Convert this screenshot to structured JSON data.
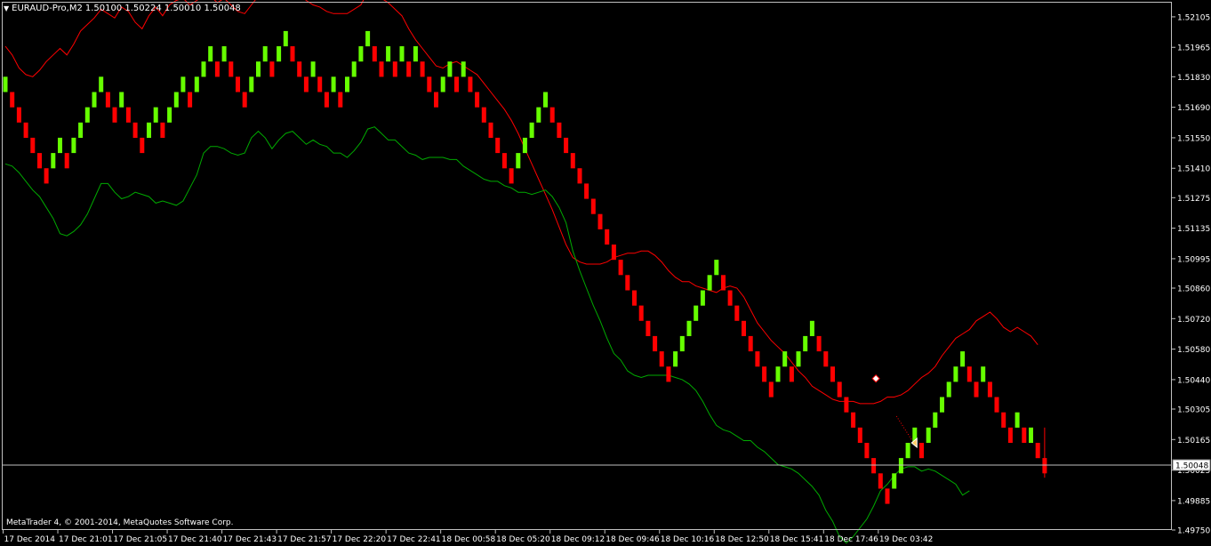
{
  "header": {
    "menu_icon": "triangle-down-icon",
    "symbol": "EURAUD-Pro,M2",
    "ohlc": "1.50100 1.50224 1.50010 1.50048"
  },
  "footer": {
    "copyright": "MetaTrader 4, © 2001-2014, MetaQuotes Software Corp."
  },
  "colors": {
    "background": "#000000",
    "bull": "#66ff00",
    "bear": "#ff0000",
    "upper_band": "#ff0000",
    "lower_band": "#00aa00",
    "frame": "#c0c0c0",
    "text": "#ffffff",
    "price_line": "#c0c0c0"
  },
  "chart_data": {
    "type": "renko",
    "symbol": "EURAUD-Pro",
    "timeframe": "M2",
    "box_size": 0.0007,
    "current_price": 1.50048,
    "current_price_label": "1.50048",
    "ylim": [
      1.4975,
      1.5217
    ],
    "y_ticks": [
      "1.52105",
      "1.51965",
      "1.51830",
      "1.51690",
      "1.51550",
      "1.51410",
      "1.51275",
      "1.51135",
      "1.50995",
      "1.50860",
      "1.50720",
      "1.50580",
      "1.50440",
      "1.50305",
      "1.50165",
      "1.50025",
      "1.49885",
      "1.49750"
    ],
    "y_tick_values": [
      1.52105,
      1.51965,
      1.5183,
      1.5169,
      1.5155,
      1.5141,
      1.51275,
      1.51135,
      1.50995,
      1.5086,
      1.5072,
      1.5058,
      1.5044,
      1.50305,
      1.50165,
      1.50025,
      1.49885,
      1.4975
    ],
    "x_ticks": [
      "17 Dec 2014",
      "17 Dec 21:01",
      "17 Dec 21:05",
      "17 Dec 21:40",
      "17 Dec 21:43",
      "17 Dec 21:57",
      "17 Dec 22:20",
      "17 Dec 22:41",
      "18 Dec 00:58",
      "18 Dec 05:20",
      "18 Dec 09:12",
      "18 Dec 09:46",
      "18 Dec 10:16",
      "18 Dec 12:50",
      "18 Dec 15:41",
      "18 Dec 17:46",
      "19 Dec 03:42"
    ],
    "x_tick_bar_index": [
      0,
      8,
      16,
      24,
      32,
      40,
      48,
      56,
      64,
      72,
      80,
      88,
      96,
      104,
      112,
      120,
      128
    ],
    "bars": [
      {
        "c": "up",
        "lo": 1.5176,
        "hi": 1.5183
      },
      {
        "c": "dn",
        "lo": 1.5169,
        "hi": 1.5176
      },
      {
        "c": "dn",
        "lo": 1.5162,
        "hi": 1.5169
      },
      {
        "c": "dn",
        "lo": 1.5155,
        "hi": 1.5162
      },
      {
        "c": "dn",
        "lo": 1.5148,
        "hi": 1.5155
      },
      {
        "c": "dn",
        "lo": 1.5141,
        "hi": 1.5148
      },
      {
        "c": "dn",
        "lo": 1.5134,
        "hi": 1.5141
      },
      {
        "c": "up",
        "lo": 1.5141,
        "hi": 1.5148
      },
      {
        "c": "up",
        "lo": 1.5148,
        "hi": 1.5155
      },
      {
        "c": "dn",
        "lo": 1.5141,
        "hi": 1.5148
      },
      {
        "c": "up",
        "lo": 1.5148,
        "hi": 1.5155
      },
      {
        "c": "up",
        "lo": 1.5155,
        "hi": 1.5162
      },
      {
        "c": "up",
        "lo": 1.5162,
        "hi": 1.5169
      },
      {
        "c": "up",
        "lo": 1.5169,
        "hi": 1.5176
      },
      {
        "c": "up",
        "lo": 1.5176,
        "hi": 1.5183
      },
      {
        "c": "dn",
        "lo": 1.5169,
        "hi": 1.5176
      },
      {
        "c": "dn",
        "lo": 1.5162,
        "hi": 1.5169
      },
      {
        "c": "up",
        "lo": 1.5169,
        "hi": 1.5176
      },
      {
        "c": "dn",
        "lo": 1.5162,
        "hi": 1.5169
      },
      {
        "c": "dn",
        "lo": 1.5155,
        "hi": 1.5162
      },
      {
        "c": "dn",
        "lo": 1.5148,
        "hi": 1.5155
      },
      {
        "c": "up",
        "lo": 1.5155,
        "hi": 1.5162
      },
      {
        "c": "up",
        "lo": 1.5162,
        "hi": 1.5169
      },
      {
        "c": "dn",
        "lo": 1.5155,
        "hi": 1.5162
      },
      {
        "c": "up",
        "lo": 1.5162,
        "hi": 1.5169
      },
      {
        "c": "up",
        "lo": 1.5169,
        "hi": 1.5176
      },
      {
        "c": "up",
        "lo": 1.5176,
        "hi": 1.5183
      },
      {
        "c": "dn",
        "lo": 1.5169,
        "hi": 1.5176
      },
      {
        "c": "up",
        "lo": 1.5176,
        "hi": 1.5183
      },
      {
        "c": "up",
        "lo": 1.5183,
        "hi": 1.519
      },
      {
        "c": "up",
        "lo": 1.519,
        "hi": 1.5197
      },
      {
        "c": "dn",
        "lo": 1.5183,
        "hi": 1.519
      },
      {
        "c": "up",
        "lo": 1.519,
        "hi": 1.5197
      },
      {
        "c": "dn",
        "lo": 1.5183,
        "hi": 1.519
      },
      {
        "c": "dn",
        "lo": 1.5176,
        "hi": 1.5183
      },
      {
        "c": "dn",
        "lo": 1.5169,
        "hi": 1.5176
      },
      {
        "c": "up",
        "lo": 1.5176,
        "hi": 1.5183
      },
      {
        "c": "up",
        "lo": 1.5183,
        "hi": 1.519
      },
      {
        "c": "up",
        "lo": 1.519,
        "hi": 1.5197
      },
      {
        "c": "dn",
        "lo": 1.5183,
        "hi": 1.519
      },
      {
        "c": "up",
        "lo": 1.519,
        "hi": 1.5197
      },
      {
        "c": "up",
        "lo": 1.5197,
        "hi": 1.5204
      },
      {
        "c": "dn",
        "lo": 1.519,
        "hi": 1.5197
      },
      {
        "c": "dn",
        "lo": 1.5183,
        "hi": 1.519
      },
      {
        "c": "dn",
        "lo": 1.5176,
        "hi": 1.5183
      },
      {
        "c": "up",
        "lo": 1.5183,
        "hi": 1.519
      },
      {
        "c": "dn",
        "lo": 1.5176,
        "hi": 1.5183
      },
      {
        "c": "dn",
        "lo": 1.5169,
        "hi": 1.5176
      },
      {
        "c": "up",
        "lo": 1.5176,
        "hi": 1.5183
      },
      {
        "c": "dn",
        "lo": 1.5169,
        "hi": 1.5176
      },
      {
        "c": "up",
        "lo": 1.5176,
        "hi": 1.5183
      },
      {
        "c": "up",
        "lo": 1.5183,
        "hi": 1.519
      },
      {
        "c": "up",
        "lo": 1.519,
        "hi": 1.5197
      },
      {
        "c": "up",
        "lo": 1.5197,
        "hi": 1.5204
      },
      {
        "c": "dn",
        "lo": 1.519,
        "hi": 1.5197
      },
      {
        "c": "dn",
        "lo": 1.5183,
        "hi": 1.519
      },
      {
        "c": "up",
        "lo": 1.519,
        "hi": 1.5197
      },
      {
        "c": "dn",
        "lo": 1.5183,
        "hi": 1.519
      },
      {
        "c": "up",
        "lo": 1.519,
        "hi": 1.5197
      },
      {
        "c": "dn",
        "lo": 1.5183,
        "hi": 1.519
      },
      {
        "c": "up",
        "lo": 1.519,
        "hi": 1.5197
      },
      {
        "c": "dn",
        "lo": 1.5183,
        "hi": 1.519
      },
      {
        "c": "dn",
        "lo": 1.5176,
        "hi": 1.5183
      },
      {
        "c": "dn",
        "lo": 1.5169,
        "hi": 1.5176
      },
      {
        "c": "up",
        "lo": 1.5176,
        "hi": 1.5183
      },
      {
        "c": "up",
        "lo": 1.5183,
        "hi": 1.519
      },
      {
        "c": "dn",
        "lo": 1.5176,
        "hi": 1.5183
      },
      {
        "c": "up",
        "lo": 1.5183,
        "hi": 1.519
      },
      {
        "c": "dn",
        "lo": 1.5176,
        "hi": 1.5183
      },
      {
        "c": "dn",
        "lo": 1.5169,
        "hi": 1.5176
      },
      {
        "c": "dn",
        "lo": 1.5162,
        "hi": 1.5169
      },
      {
        "c": "dn",
        "lo": 1.5155,
        "hi": 1.5162
      },
      {
        "c": "dn",
        "lo": 1.5148,
        "hi": 1.5155
      },
      {
        "c": "dn",
        "lo": 1.5141,
        "hi": 1.5148
      },
      {
        "c": "dn",
        "lo": 1.5134,
        "hi": 1.5141
      },
      {
        "c": "up",
        "lo": 1.5141,
        "hi": 1.5148
      },
      {
        "c": "up",
        "lo": 1.5148,
        "hi": 1.5155
      },
      {
        "c": "up",
        "lo": 1.5155,
        "hi": 1.5162
      },
      {
        "c": "up",
        "lo": 1.5162,
        "hi": 1.5169
      },
      {
        "c": "up",
        "lo": 1.5169,
        "hi": 1.5176
      },
      {
        "c": "dn",
        "lo": 1.5162,
        "hi": 1.5169
      },
      {
        "c": "dn",
        "lo": 1.5155,
        "hi": 1.5162
      },
      {
        "c": "dn",
        "lo": 1.5148,
        "hi": 1.5155
      },
      {
        "c": "dn",
        "lo": 1.5141,
        "hi": 1.5148
      },
      {
        "c": "dn",
        "lo": 1.5134,
        "hi": 1.5141
      },
      {
        "c": "dn",
        "lo": 1.5127,
        "hi": 1.5134
      },
      {
        "c": "dn",
        "lo": 1.512,
        "hi": 1.5127
      },
      {
        "c": "dn",
        "lo": 1.5113,
        "hi": 1.512
      },
      {
        "c": "dn",
        "lo": 1.5106,
        "hi": 1.5113
      },
      {
        "c": "dn",
        "lo": 1.5099,
        "hi": 1.5106
      },
      {
        "c": "dn",
        "lo": 1.5092,
        "hi": 1.5099
      },
      {
        "c": "dn",
        "lo": 1.5085,
        "hi": 1.5092
      },
      {
        "c": "dn",
        "lo": 1.5078,
        "hi": 1.5085
      },
      {
        "c": "dn",
        "lo": 1.5071,
        "hi": 1.5078
      },
      {
        "c": "dn",
        "lo": 1.5064,
        "hi": 1.5071
      },
      {
        "c": "dn",
        "lo": 1.5057,
        "hi": 1.5064
      },
      {
        "c": "dn",
        "lo": 1.505,
        "hi": 1.5057
      },
      {
        "c": "dn",
        "lo": 1.5043,
        "hi": 1.505
      },
      {
        "c": "up",
        "lo": 1.505,
        "hi": 1.5057
      },
      {
        "c": "up",
        "lo": 1.5057,
        "hi": 1.5064
      },
      {
        "c": "up",
        "lo": 1.5064,
        "hi": 1.5071
      },
      {
        "c": "up",
        "lo": 1.5071,
        "hi": 1.5078
      },
      {
        "c": "up",
        "lo": 1.5078,
        "hi": 1.5085
      },
      {
        "c": "up",
        "lo": 1.5085,
        "hi": 1.5092
      },
      {
        "c": "up",
        "lo": 1.5092,
        "hi": 1.5099
      },
      {
        "c": "dn",
        "lo": 1.5085,
        "hi": 1.5092
      },
      {
        "c": "dn",
        "lo": 1.5078,
        "hi": 1.5085
      },
      {
        "c": "dn",
        "lo": 1.5071,
        "hi": 1.5078
      },
      {
        "c": "dn",
        "lo": 1.5064,
        "hi": 1.5071
      },
      {
        "c": "dn",
        "lo": 1.5057,
        "hi": 1.5064
      },
      {
        "c": "dn",
        "lo": 1.505,
        "hi": 1.5057
      },
      {
        "c": "dn",
        "lo": 1.5043,
        "hi": 1.505
      },
      {
        "c": "dn",
        "lo": 1.5036,
        "hi": 1.5043
      },
      {
        "c": "up",
        "lo": 1.5043,
        "hi": 1.505
      },
      {
        "c": "up",
        "lo": 1.505,
        "hi": 1.5057
      },
      {
        "c": "dn",
        "lo": 1.5043,
        "hi": 1.505
      },
      {
        "c": "up",
        "lo": 1.505,
        "hi": 1.5057
      },
      {
        "c": "up",
        "lo": 1.5057,
        "hi": 1.5064
      },
      {
        "c": "up",
        "lo": 1.5064,
        "hi": 1.5071
      },
      {
        "c": "dn",
        "lo": 1.5057,
        "hi": 1.5064
      },
      {
        "c": "dn",
        "lo": 1.505,
        "hi": 1.5057
      },
      {
        "c": "dn",
        "lo": 1.5043,
        "hi": 1.505
      },
      {
        "c": "dn",
        "lo": 1.5036,
        "hi": 1.5043
      },
      {
        "c": "dn",
        "lo": 1.5029,
        "hi": 1.5036
      },
      {
        "c": "dn",
        "lo": 1.5022,
        "hi": 1.5029
      },
      {
        "c": "dn",
        "lo": 1.5015,
        "hi": 1.5022
      },
      {
        "c": "dn",
        "lo": 1.5008,
        "hi": 1.5015
      },
      {
        "c": "dn",
        "lo": 1.5001,
        "hi": 1.5008
      },
      {
        "c": "dn",
        "lo": 1.4994,
        "hi": 1.5001
      },
      {
        "c": "dn",
        "lo": 1.4987,
        "hi": 1.4994
      },
      {
        "c": "up",
        "lo": 1.4994,
        "hi": 1.5001
      },
      {
        "c": "up",
        "lo": 1.5001,
        "hi": 1.5008
      },
      {
        "c": "up",
        "lo": 1.5008,
        "hi": 1.5015
      },
      {
        "c": "up",
        "lo": 1.5015,
        "hi": 1.5022
      },
      {
        "c": "dn",
        "lo": 1.5008,
        "hi": 1.5015
      },
      {
        "c": "up",
        "lo": 1.5015,
        "hi": 1.5022
      },
      {
        "c": "up",
        "lo": 1.5022,
        "hi": 1.5029
      },
      {
        "c": "up",
        "lo": 1.5029,
        "hi": 1.5036
      },
      {
        "c": "up",
        "lo": 1.5036,
        "hi": 1.5043
      },
      {
        "c": "up",
        "lo": 1.5043,
        "hi": 1.505
      },
      {
        "c": "up",
        "lo": 1.505,
        "hi": 1.5057
      },
      {
        "c": "dn",
        "lo": 1.5043,
        "hi": 1.505
      },
      {
        "c": "dn",
        "lo": 1.5036,
        "hi": 1.5043
      },
      {
        "c": "up",
        "lo": 1.5043,
        "hi": 1.505
      },
      {
        "c": "dn",
        "lo": 1.5036,
        "hi": 1.5043
      },
      {
        "c": "dn",
        "lo": 1.5029,
        "hi": 1.5036
      },
      {
        "c": "dn",
        "lo": 1.5022,
        "hi": 1.5029
      },
      {
        "c": "dn",
        "lo": 1.5015,
        "hi": 1.5022
      },
      {
        "c": "up",
        "lo": 1.5022,
        "hi": 1.5029
      },
      {
        "c": "dn",
        "lo": 1.5015,
        "hi": 1.5022
      },
      {
        "c": "up",
        "lo": 1.5015,
        "hi": 1.5022
      },
      {
        "c": "dn",
        "lo": 1.5008,
        "hi": 1.5015
      },
      {
        "c": "dn",
        "lo": 1.5001,
        "hi": 1.5008
      }
    ],
    "upper_band": [
      1.5197,
      1.5193,
      1.5187,
      1.5184,
      1.5183,
      1.5186,
      1.519,
      1.5193,
      1.5196,
      1.5193,
      1.5198,
      1.5204,
      1.5207,
      1.521,
      1.5214,
      1.5212,
      1.521,
      1.5215,
      1.5213,
      1.5208,
      1.5205,
      1.5211,
      1.5215,
      1.5211,
      1.5216,
      1.5218,
      1.5219,
      1.5216,
      1.5218,
      1.522,
      1.522,
      1.5217,
      1.5219,
      1.5216,
      1.5213,
      1.5212,
      1.5216,
      1.522,
      1.522,
      1.5219,
      1.522,
      1.522,
      1.5222,
      1.5221,
      1.5218,
      1.5216,
      1.5215,
      1.5213,
      1.5212,
      1.5212,
      1.5212,
      1.5214,
      1.5216,
      1.5222,
      1.5222,
      1.5219,
      1.5217,
      1.5214,
      1.5211,
      1.5205,
      1.52,
      1.5196,
      1.5192,
      1.5188,
      1.5187,
      1.5189,
      1.519,
      1.5188,
      1.5186,
      1.5184,
      1.518,
      1.5176,
      1.5172,
      1.5168,
      1.5163,
      1.5157,
      1.515,
      1.5143,
      1.5136,
      1.5129,
      1.5122,
      1.5114,
      1.5106,
      1.51,
      1.5098,
      1.5097,
      1.5097,
      1.5097,
      1.5098,
      1.51,
      1.5101,
      1.5102,
      1.5102,
      1.5103,
      1.5103,
      1.5101,
      1.5098,
      1.5094,
      1.5091,
      1.5089,
      1.5089,
      1.5087,
      1.5086,
      1.5085,
      1.5084,
      1.5086,
      1.5087,
      1.5086,
      1.5082,
      1.5076,
      1.507,
      1.5066,
      1.5062,
      1.5059,
      1.5056,
      1.5052,
      1.5048,
      1.5045,
      1.5041,
      1.5039,
      1.5037,
      1.5035,
      1.5034,
      1.5034,
      1.5034,
      1.5033,
      1.5033,
      1.5033,
      1.5034,
      1.5036,
      1.5036,
      1.5037,
      1.5039,
      1.5042,
      1.5045,
      1.5047,
      1.505,
      1.5055,
      1.5059,
      1.5063,
      1.5065,
      1.5067,
      1.5071,
      1.5073,
      1.5075,
      1.5072,
      1.5068,
      1.5066,
      1.5068,
      1.5066,
      1.5064,
      1.506
    ],
    "lower_band": [
      1.5143,
      1.5142,
      1.5139,
      1.5135,
      1.5131,
      1.5128,
      1.5123,
      1.5118,
      1.5111,
      1.511,
      1.5112,
      1.5115,
      1.512,
      1.5127,
      1.5134,
      1.5134,
      1.513,
      1.5127,
      1.5128,
      1.513,
      1.5129,
      1.5128,
      1.5125,
      1.5126,
      1.5125,
      1.5124,
      1.5126,
      1.5132,
      1.5138,
      1.5148,
      1.5151,
      1.5151,
      1.515,
      1.5148,
      1.5147,
      1.5148,
      1.5155,
      1.5158,
      1.5155,
      1.515,
      1.5154,
      1.5157,
      1.5158,
      1.5155,
      1.5152,
      1.5154,
      1.5152,
      1.5151,
      1.5148,
      1.5148,
      1.5146,
      1.5149,
      1.5153,
      1.5159,
      1.516,
      1.5157,
      1.5154,
      1.5154,
      1.5151,
      1.5148,
      1.5147,
      1.5145,
      1.5146,
      1.5146,
      1.5146,
      1.5145,
      1.5145,
      1.5142,
      1.514,
      1.5138,
      1.5136,
      1.5135,
      1.5135,
      1.5133,
      1.5132,
      1.513,
      1.513,
      1.5129,
      1.513,
      1.5131,
      1.5128,
      1.5123,
      1.5116,
      1.5103,
      1.5094,
      1.5086,
      1.5078,
      1.5071,
      1.5063,
      1.5056,
      1.5053,
      1.5048,
      1.5046,
      1.5045,
      1.5046,
      1.5046,
      1.5046,
      1.5046,
      1.5045,
      1.5044,
      1.5042,
      1.5039,
      1.5034,
      1.5028,
      1.5023,
      1.5021,
      1.502,
      1.5018,
      1.5016,
      1.5016,
      1.5013,
      1.5011,
      1.5008,
      1.5005,
      1.5004,
      1.5003,
      1.5001,
      1.4998,
      1.4995,
      1.4991,
      1.4984,
      1.4979,
      1.4972,
      1.4969,
      1.4972,
      1.4976,
      1.498,
      1.4986,
      1.4993,
      1.4996,
      1.5,
      1.5003,
      1.5004,
      1.5004,
      1.5002,
      1.5003,
      1.5002,
      1.5,
      1.4998,
      1.4996,
      1.4991,
      1.4993
    ]
  }
}
